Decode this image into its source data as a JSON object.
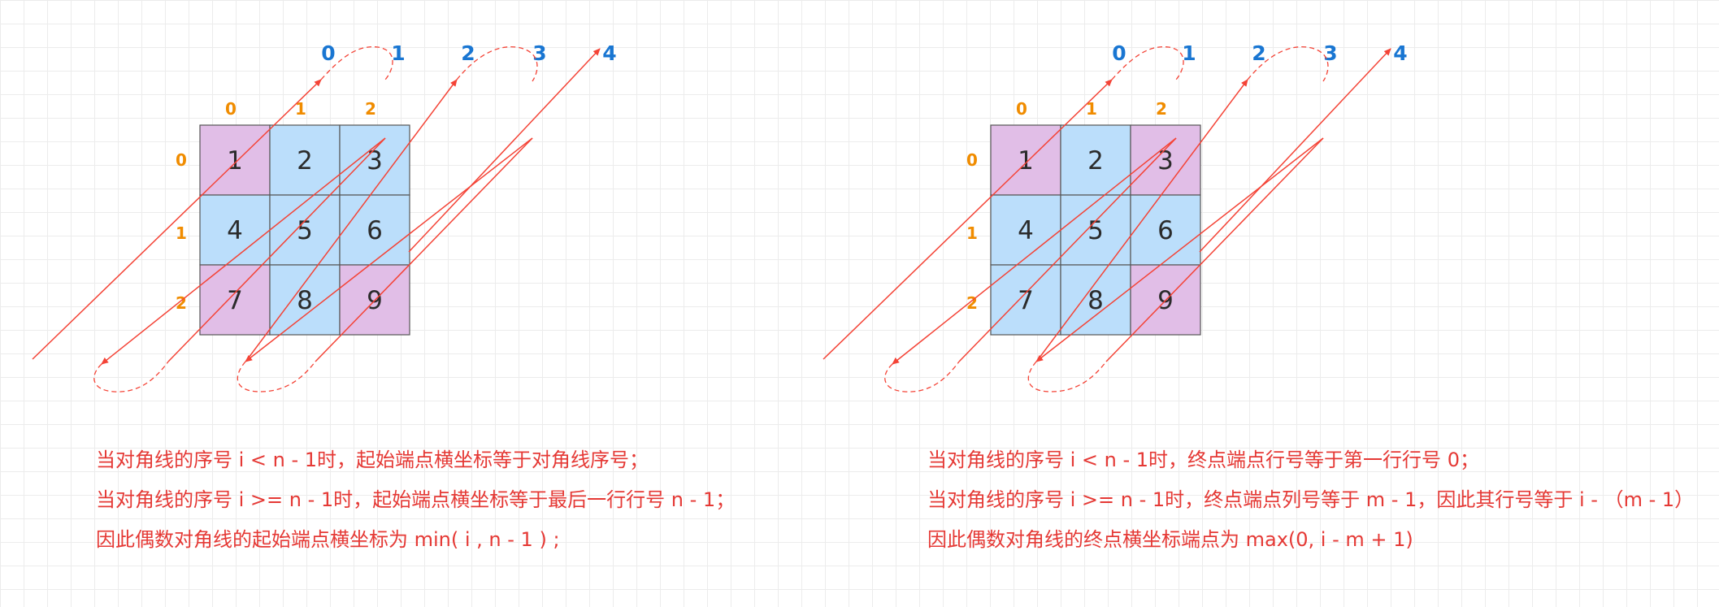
{
  "colors": {
    "grid_line": "#ececec",
    "cell_highlight": "#e1bee7",
    "cell_normal": "#bbdefb",
    "cell_border": "#555555",
    "arrow": "#f44336",
    "diagonal_label": "#1976d2",
    "index_label": "#f08c00",
    "note_text": "#e53935"
  },
  "left_diagram": {
    "diagonal_labels": [
      "0",
      "1",
      "2",
      "3",
      "4"
    ],
    "column_labels": [
      "0",
      "1",
      "2"
    ],
    "row_labels": [
      "0",
      "1",
      "2"
    ],
    "cells": [
      {
        "value": "1",
        "highlight": true
      },
      {
        "value": "2",
        "highlight": false
      },
      {
        "value": "3",
        "highlight": false
      },
      {
        "value": "4",
        "highlight": false
      },
      {
        "value": "5",
        "highlight": false
      },
      {
        "value": "6",
        "highlight": false
      },
      {
        "value": "7",
        "highlight": true
      },
      {
        "value": "8",
        "highlight": false
      },
      {
        "value": "9",
        "highlight": true
      }
    ],
    "notes": [
      "当对角线的序号 i <   n - 1时，起始端点横坐标等于对角线序号；",
      "当对角线的序号 i >= n - 1时，起始端点横坐标等于最后一行行号 n - 1；",
      "因此偶数对角线的起始端点横坐标为 min( i , n - 1 ) ;"
    ]
  },
  "right_diagram": {
    "diagonal_labels": [
      "0",
      "1",
      "2",
      "3",
      "4"
    ],
    "column_labels": [
      "0",
      "1",
      "2"
    ],
    "row_labels": [
      "0",
      "1",
      "2"
    ],
    "cells": [
      {
        "value": "1",
        "highlight": true
      },
      {
        "value": "2",
        "highlight": false
      },
      {
        "value": "3",
        "highlight": true
      },
      {
        "value": "4",
        "highlight": false
      },
      {
        "value": "5",
        "highlight": false
      },
      {
        "value": "6",
        "highlight": false
      },
      {
        "value": "7",
        "highlight": false
      },
      {
        "value": "8",
        "highlight": false
      },
      {
        "value": "9",
        "highlight": true
      }
    ],
    "notes": [
      "当对角线的序号 i <   n - 1时，终点端点行号等于第一行行号 0；",
      "当对角线的序号 i >= n - 1时，终点端点列号等于 m - 1，因此其行号等于 i - （m - 1）",
      "因此偶数对角线的终点横坐标端点为 max(0, i - m + 1)"
    ]
  }
}
